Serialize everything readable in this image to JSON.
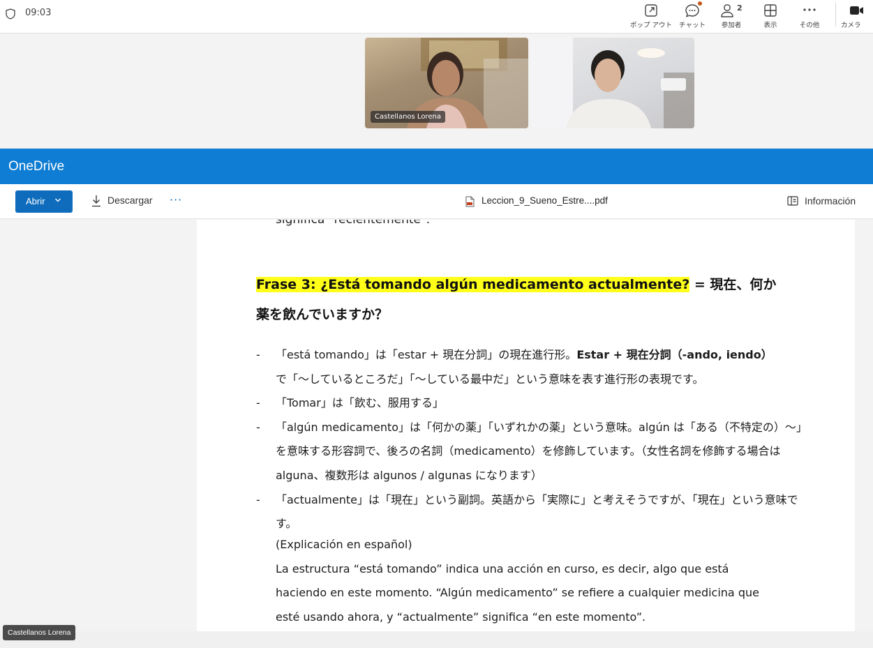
{
  "meeting": {
    "time": "09:03",
    "toolbar": {
      "popout": "ポップ アウト",
      "chat": "チャット",
      "participants": "参加者",
      "participants_count": "2",
      "view": "表示",
      "more": "その他",
      "camera": "カメラ"
    },
    "videos": [
      {
        "name": "Castellanos Lorena"
      },
      {
        "name": ""
      }
    ],
    "self_view_name": "Castellanos Lorena"
  },
  "onedrive": {
    "title": "OneDrive",
    "commands": {
      "open_label": "Abrir",
      "download_label": "Descargar",
      "more_label": "···",
      "file_name": "Leccion_9_Sueno_Estre....pdf",
      "info_label": "Información"
    }
  },
  "document": {
    "cut_line": "significa \"recientemente\".",
    "heading_highlight": "Frase 3: ¿Está tomando algún medicamento actualmente?",
    "heading_rest": " = 現在、何か",
    "heading_line2": "薬を飲んでいますか？",
    "bullets": [
      {
        "dash": "-",
        "line1_pre": "「está tomando」は「estar + 現在分詞」の現在進行形。",
        "line1_bold": "Estar + 現在分詞（-ando, iendo）",
        "line2": "で「～しているところだ」「～している最中だ」という意味を表す進行形の表現です。"
      },
      {
        "dash": "-",
        "line1_pre": "「Tomar」は「飲む、服用する」"
      },
      {
        "dash": "-",
        "line1_pre": "「algún medicamento」は「何かの薬」「いずれかの薬」という意味。algún は「ある（不特定の）～」",
        "line2": "を意味する形容詞で、後ろの名詞（medicamento）を修飾しています。（女性名詞を修飾する場合は",
        "line3": "alguna、複数形は algunos / algunas になります）"
      },
      {
        "dash": "-",
        "line1_pre": "「actualmente」は「現在」という副詞。英語から「実際に」と考えそうですが、「現在」という意味です。"
      }
    ],
    "spanish": {
      "heading": "(Explicación en español)",
      "line1": "La estructura “está tomando” indica una acción en curso, es decir, algo que está",
      "line2": "haciendo en este momento. “Algún medicamento” se refiere a cualquier medicina que",
      "line3": "esté usando ahora, y “actualmente” significa “en este momento”."
    }
  }
}
